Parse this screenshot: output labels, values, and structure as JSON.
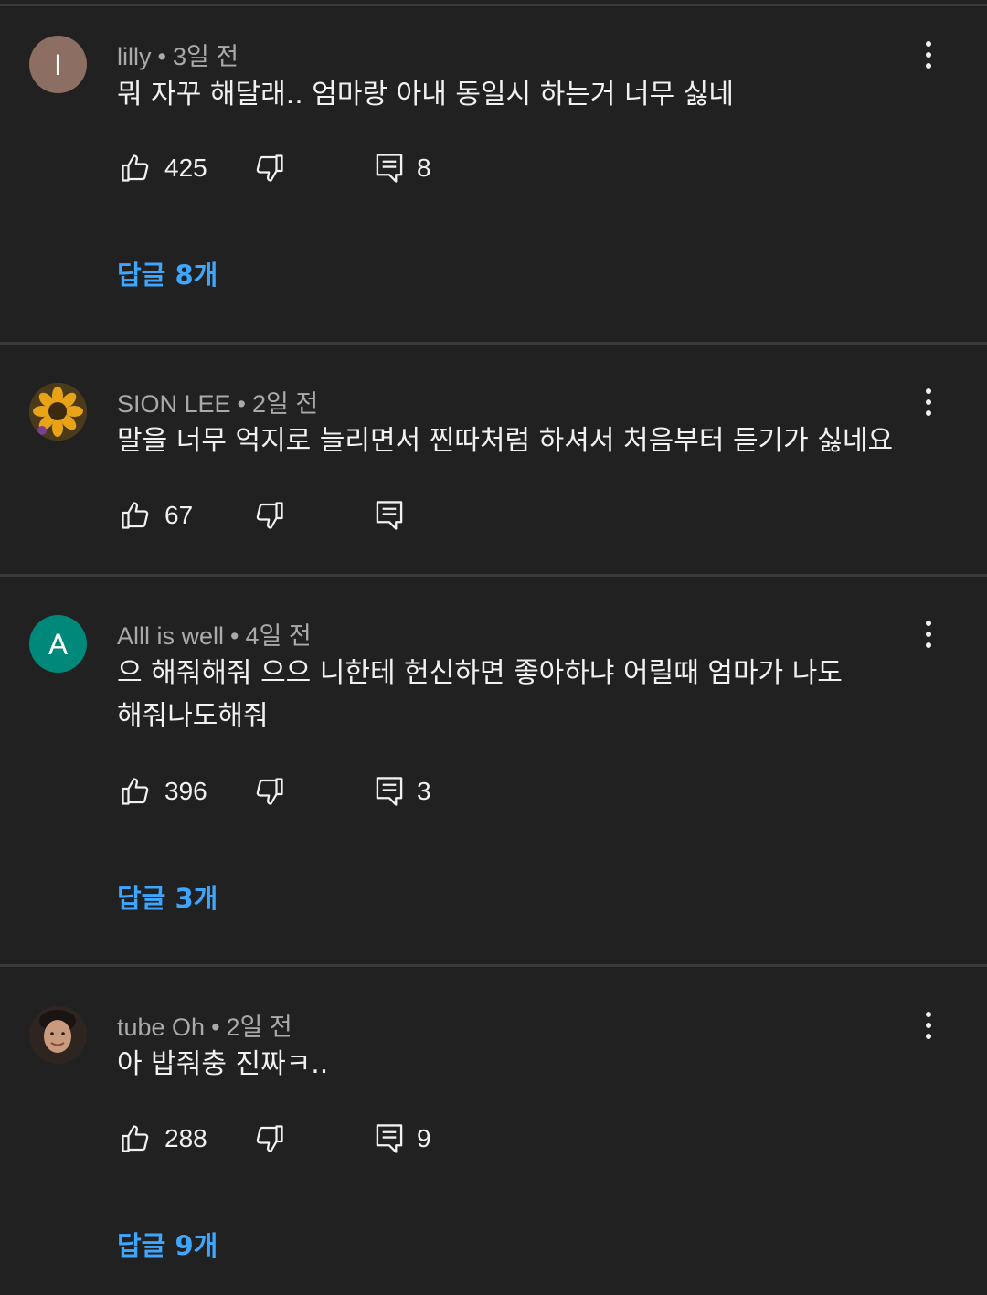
{
  "accent_color": "#3ea6ff",
  "comments": [
    {
      "author": "lilly",
      "separator": "•",
      "time": "3일 전",
      "avatar": {
        "type": "letter",
        "letter": "I",
        "color": "#8d6e63"
      },
      "text": "뭐 자꾸 해달래.. 엄마랑 아내 동일시 하는거 너무 싫네",
      "likes": "425",
      "reply_count": "8",
      "replies_link": "답글 8개"
    },
    {
      "author": "SION LEE",
      "separator": "•",
      "time": "2일 전",
      "avatar": {
        "type": "image",
        "description_icon": "sunflower-avatar"
      },
      "text": "말을 너무 억지로 늘리면서 찐따처럼 하셔서 처음부터 듣기가 싫네요",
      "likes": "67",
      "reply_count": "",
      "replies_link": ""
    },
    {
      "author": "Alll is well",
      "separator": "•",
      "time": "4일 전",
      "avatar": {
        "type": "letter",
        "letter": "A",
        "color": "#00897b"
      },
      "text": "으 해줘해줘 으으 니한테 헌신하면 좋아하냐  어릴때 엄마가 나도\n해줘나도해줘",
      "likes": "396",
      "reply_count": "3",
      "replies_link": "답글 3개"
    },
    {
      "author": "tube Oh",
      "separator": "•",
      "time": "2일 전",
      "avatar": {
        "type": "image",
        "description_icon": "person-photo-avatar"
      },
      "text": "아 밥줘충 진짜ㅋ..",
      "likes": "288",
      "reply_count": "9",
      "replies_link": "답글 9개"
    }
  ]
}
